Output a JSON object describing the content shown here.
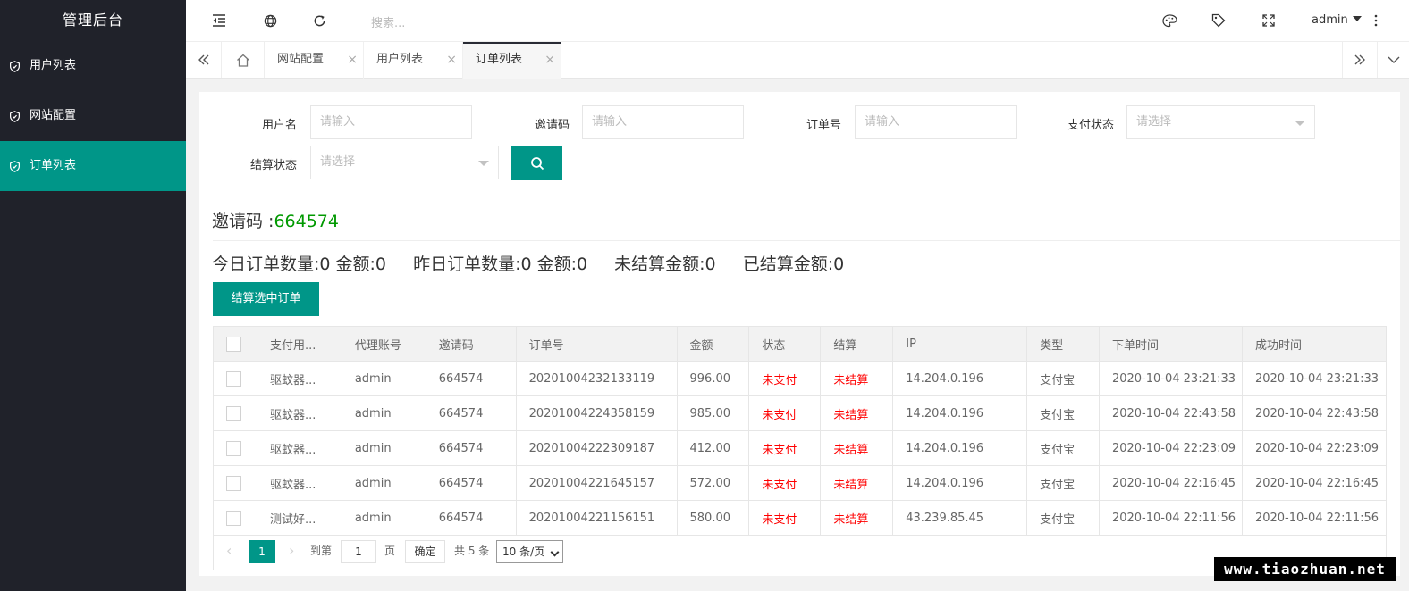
{
  "app": {
    "title": "管理后台"
  },
  "sidebar": {
    "items": [
      {
        "label": "用户列表"
      },
      {
        "label": "网站配置"
      },
      {
        "label": "订单列表"
      }
    ]
  },
  "header": {
    "search_placeholder": "搜索...",
    "user": "admin"
  },
  "tabs": [
    {
      "label": "网站配置"
    },
    {
      "label": "用户列表"
    },
    {
      "label": "订单列表"
    }
  ],
  "filters": {
    "username": {
      "label": "用户名",
      "placeholder": "请输入"
    },
    "invite_code": {
      "label": "邀请码",
      "placeholder": "请输入"
    },
    "order_no": {
      "label": "订单号",
      "placeholder": "请输入"
    },
    "pay_status": {
      "label": "支付状态",
      "placeholder": "请选择"
    },
    "settle_status": {
      "label": "结算状态",
      "placeholder": "请选择"
    }
  },
  "invite": {
    "label": "邀请码 :",
    "code": "664574"
  },
  "stats": {
    "today": "今日订单数量:0 金额:0",
    "yesterday": "昨日订单数量:0 金额:0",
    "unsettled": "未结算金额:0",
    "settled": "已结算金额:0"
  },
  "settle_button": "结算选中订单",
  "table": {
    "columns": [
      "支付用...",
      "代理账号",
      "邀请码",
      "订单号",
      "金额",
      "状态",
      "结算",
      "IP",
      "类型",
      "下单时间",
      "成功时间"
    ],
    "rows": [
      [
        "驱蚊器...",
        "admin",
        "664574",
        "20201004232133119",
        "996.00",
        "未支付",
        "未结算",
        "14.204.0.196",
        "支付宝",
        "2020-10-04 23:21:33",
        "2020-10-04 23:21:33"
      ],
      [
        "驱蚊器...",
        "admin",
        "664574",
        "20201004224358159",
        "985.00",
        "未支付",
        "未结算",
        "14.204.0.196",
        "支付宝",
        "2020-10-04 22:43:58",
        "2020-10-04 22:43:58"
      ],
      [
        "驱蚊器...",
        "admin",
        "664574",
        "20201004222309187",
        "412.00",
        "未支付",
        "未结算",
        "14.204.0.196",
        "支付宝",
        "2020-10-04 22:23:09",
        "2020-10-04 22:23:09"
      ],
      [
        "驱蚊器...",
        "admin",
        "664574",
        "20201004221645157",
        "572.00",
        "未支付",
        "未结算",
        "14.204.0.196",
        "支付宝",
        "2020-10-04 22:16:45",
        "2020-10-04 22:16:45"
      ],
      [
        "测试好...",
        "admin",
        "664574",
        "20201004221156151",
        "580.00",
        "未支付",
        "未结算",
        "43.239.85.45",
        "支付宝",
        "2020-10-04 22:11:56",
        "2020-10-04 22:11:56"
      ]
    ]
  },
  "pagination": {
    "current": "1",
    "goto_label": "到第",
    "goto_value": "1",
    "page_unit": "页",
    "confirm": "确定",
    "total": "共 5 条",
    "page_size": "10 条/页"
  },
  "watermark": "www.tiaozhuan.net",
  "colors": {
    "sidebar_bg": "#20222a",
    "accent": "#009688",
    "invite_code": "#009900",
    "status_red": "#ff0000"
  }
}
